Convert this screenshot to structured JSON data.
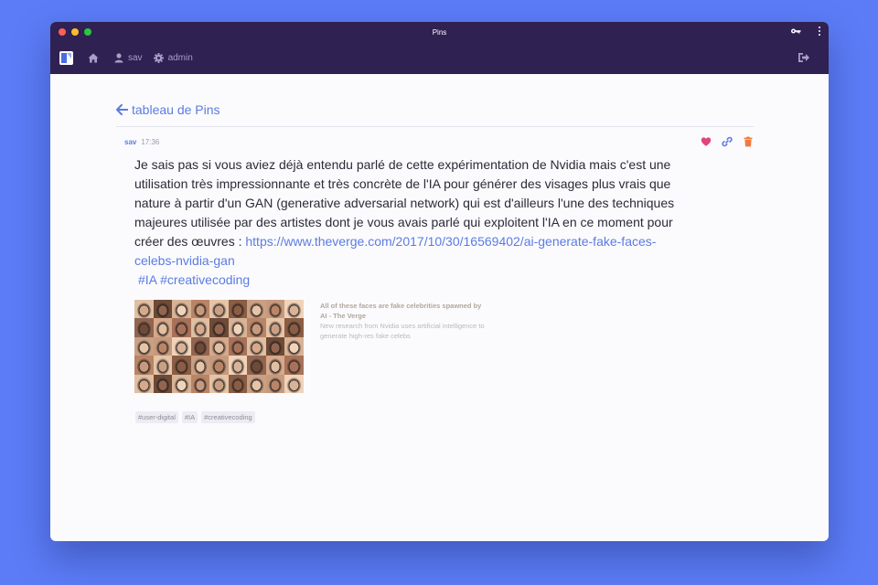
{
  "window": {
    "title": "Pins"
  },
  "nav": {
    "user": "sav",
    "admin": "admin"
  },
  "back_link": "tableau de Pins",
  "post": {
    "author": "sav",
    "time": "17:36",
    "text": "Je sais pas si vous aviez déjà entendu parlé de cette expérimentation de Nvidia mais c'est une utilisation très impressionnante et très concrète de l'IA pour générer des visages plus vrais que nature à partir d'un GAN (generative adversarial network) qui est d'ailleurs l'une des techniques majeures utilisée par des artistes dont je vous avais parlé qui exploitent l'IA en ce moment pour créer des œuvres : ",
    "link": "https://www.theverge.com/2017/10/30/16569402/ai-generate-fake-faces-celebs-nvidia-gan",
    "hashtags": "#IA #creativecoding"
  },
  "preview": {
    "title": "All of these faces are fake celebrities spawned by AI - The Verge",
    "description": "New research from Nvidia uses artificial intelligence to generate high-res fake celebs"
  },
  "tags": [
    "#user-digital",
    "#IA",
    "#creativecoding"
  ],
  "colors": {
    "background": "#5b7cf6",
    "header": "#2f2152",
    "accent": "#5b7ce0",
    "heart": "#e0457b",
    "delete": "#f07a3c"
  },
  "icons": [
    "key-icon",
    "kebab-menu-icon",
    "app-logo-icon",
    "home-icon",
    "user-icon",
    "gear-icon",
    "logout-icon",
    "arrow-left-icon",
    "heart-icon",
    "link-icon",
    "trash-icon"
  ]
}
